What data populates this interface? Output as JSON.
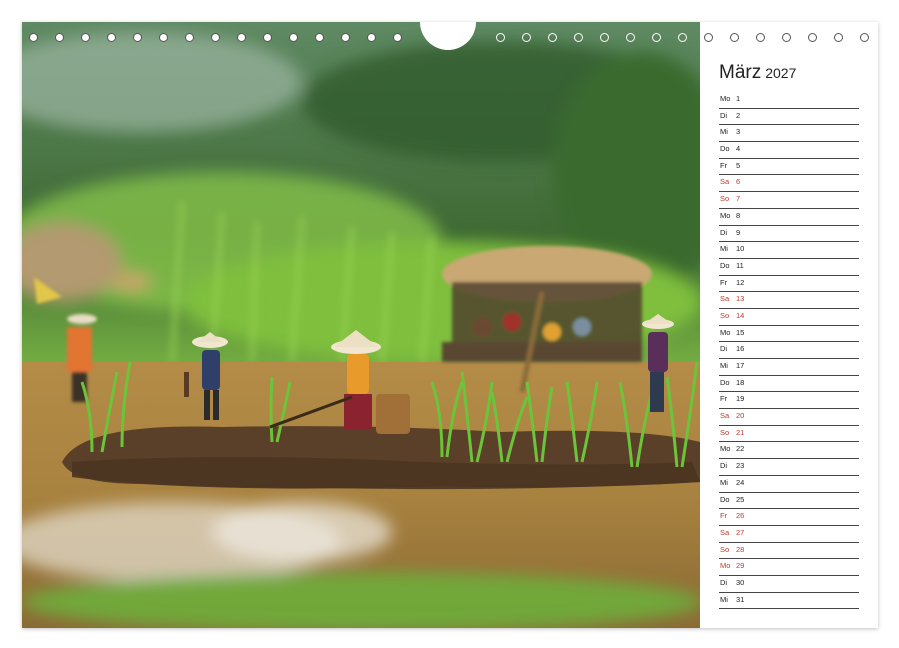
{
  "calendar": {
    "month": "März",
    "year": "2027",
    "days": [
      {
        "wd": "Mo",
        "d": "1",
        "holiday": false
      },
      {
        "wd": "Di",
        "d": "2",
        "holiday": false
      },
      {
        "wd": "Mi",
        "d": "3",
        "holiday": false
      },
      {
        "wd": "Do",
        "d": "4",
        "holiday": false
      },
      {
        "wd": "Fr",
        "d": "5",
        "holiday": false
      },
      {
        "wd": "Sa",
        "d": "6",
        "holiday": true
      },
      {
        "wd": "So",
        "d": "7",
        "holiday": true
      },
      {
        "wd": "Mo",
        "d": "8",
        "holiday": false
      },
      {
        "wd": "Di",
        "d": "9",
        "holiday": false
      },
      {
        "wd": "Mi",
        "d": "10",
        "holiday": false
      },
      {
        "wd": "Do",
        "d": "11",
        "holiday": false
      },
      {
        "wd": "Fr",
        "d": "12",
        "holiday": false
      },
      {
        "wd": "Sa",
        "d": "13",
        "holiday": true
      },
      {
        "wd": "So",
        "d": "14",
        "holiday": true
      },
      {
        "wd": "Mo",
        "d": "15",
        "holiday": false
      },
      {
        "wd": "Di",
        "d": "16",
        "holiday": false
      },
      {
        "wd": "Mi",
        "d": "17",
        "holiday": false
      },
      {
        "wd": "Do",
        "d": "18",
        "holiday": false
      },
      {
        "wd": "Fr",
        "d": "19",
        "holiday": false
      },
      {
        "wd": "Sa",
        "d": "20",
        "holiday": true
      },
      {
        "wd": "So",
        "d": "21",
        "holiday": true
      },
      {
        "wd": "Mo",
        "d": "22",
        "holiday": false
      },
      {
        "wd": "Di",
        "d": "23",
        "holiday": false
      },
      {
        "wd": "Mi",
        "d": "24",
        "holiday": false
      },
      {
        "wd": "Do",
        "d": "25",
        "holiday": false
      },
      {
        "wd": "Fr",
        "d": "26",
        "holiday": true
      },
      {
        "wd": "Sa",
        "d": "27",
        "holiday": true
      },
      {
        "wd": "So",
        "d": "28",
        "holiday": true
      },
      {
        "wd": "Mo",
        "d": "29",
        "holiday": true
      },
      {
        "wd": "Di",
        "d": "30",
        "holiday": false
      },
      {
        "wd": "Mi",
        "d": "31",
        "holiday": false
      }
    ]
  },
  "colors": {
    "holiday_text": "#c0392b",
    "normal_text": "#222222"
  },
  "photo": {
    "subject": "miniature figures working in a rice paddy"
  }
}
